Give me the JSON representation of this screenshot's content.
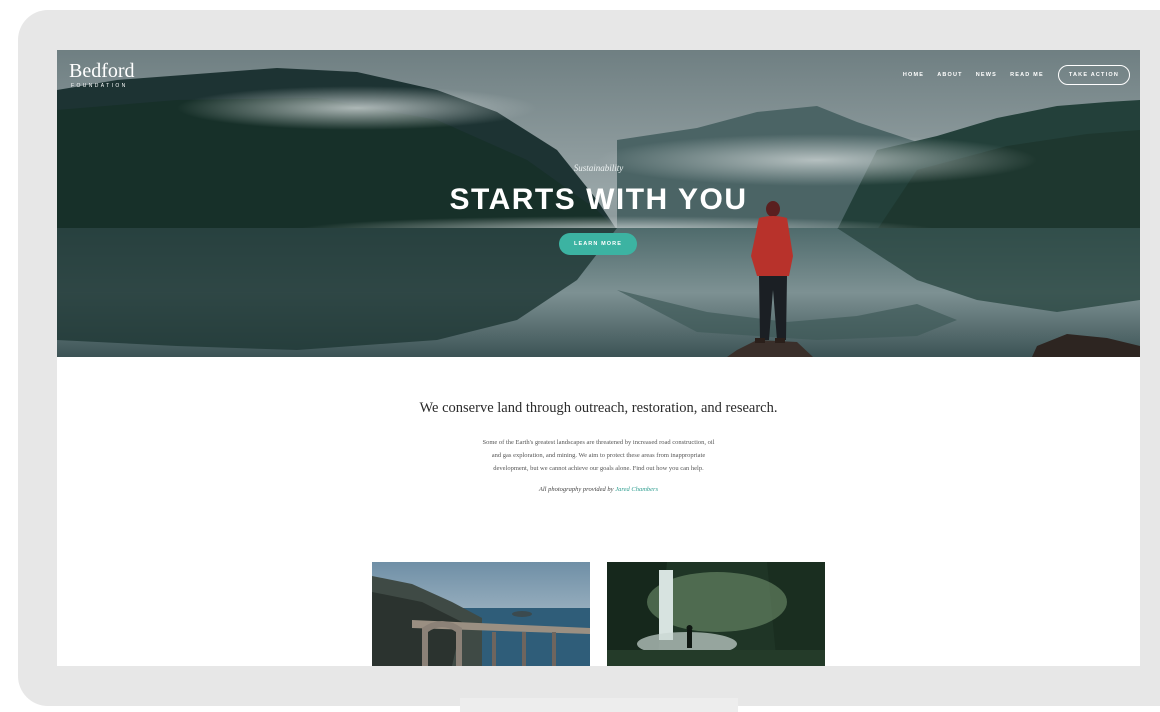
{
  "logo": {
    "name": "Bedford",
    "sub": "FOUNDATION"
  },
  "nav": {
    "items": [
      "HOME",
      "ABOUT",
      "NEWS",
      "READ ME"
    ],
    "cta": "TAKE ACTION"
  },
  "hero": {
    "kicker": "Sustainability",
    "title": "STARTS WITH YOU",
    "button": "LEARN MORE"
  },
  "intro": {
    "heading": "We conserve land through outreach, restoration, and research.",
    "body_lines": [
      "Some of the Earth's greatest landscapes are threatened by increased road construction, oil",
      "and gas exploration, and mining. We aim to protect these areas from inappropriate",
      "development, but we cannot achieve our goals alone. Find out how you can help."
    ],
    "credit_prefix": "All photography provided by",
    "credit_name": "Jared Chambers"
  },
  "colors": {
    "accent": "#3cb3a2",
    "link": "#2f9e90",
    "frame": "#e7e7e7"
  },
  "icons": {
    "hero_image": "lake-forest-photo",
    "thumb_1": "coastal-bridge-photo",
    "thumb_2": "forest-waterfall-photo"
  }
}
